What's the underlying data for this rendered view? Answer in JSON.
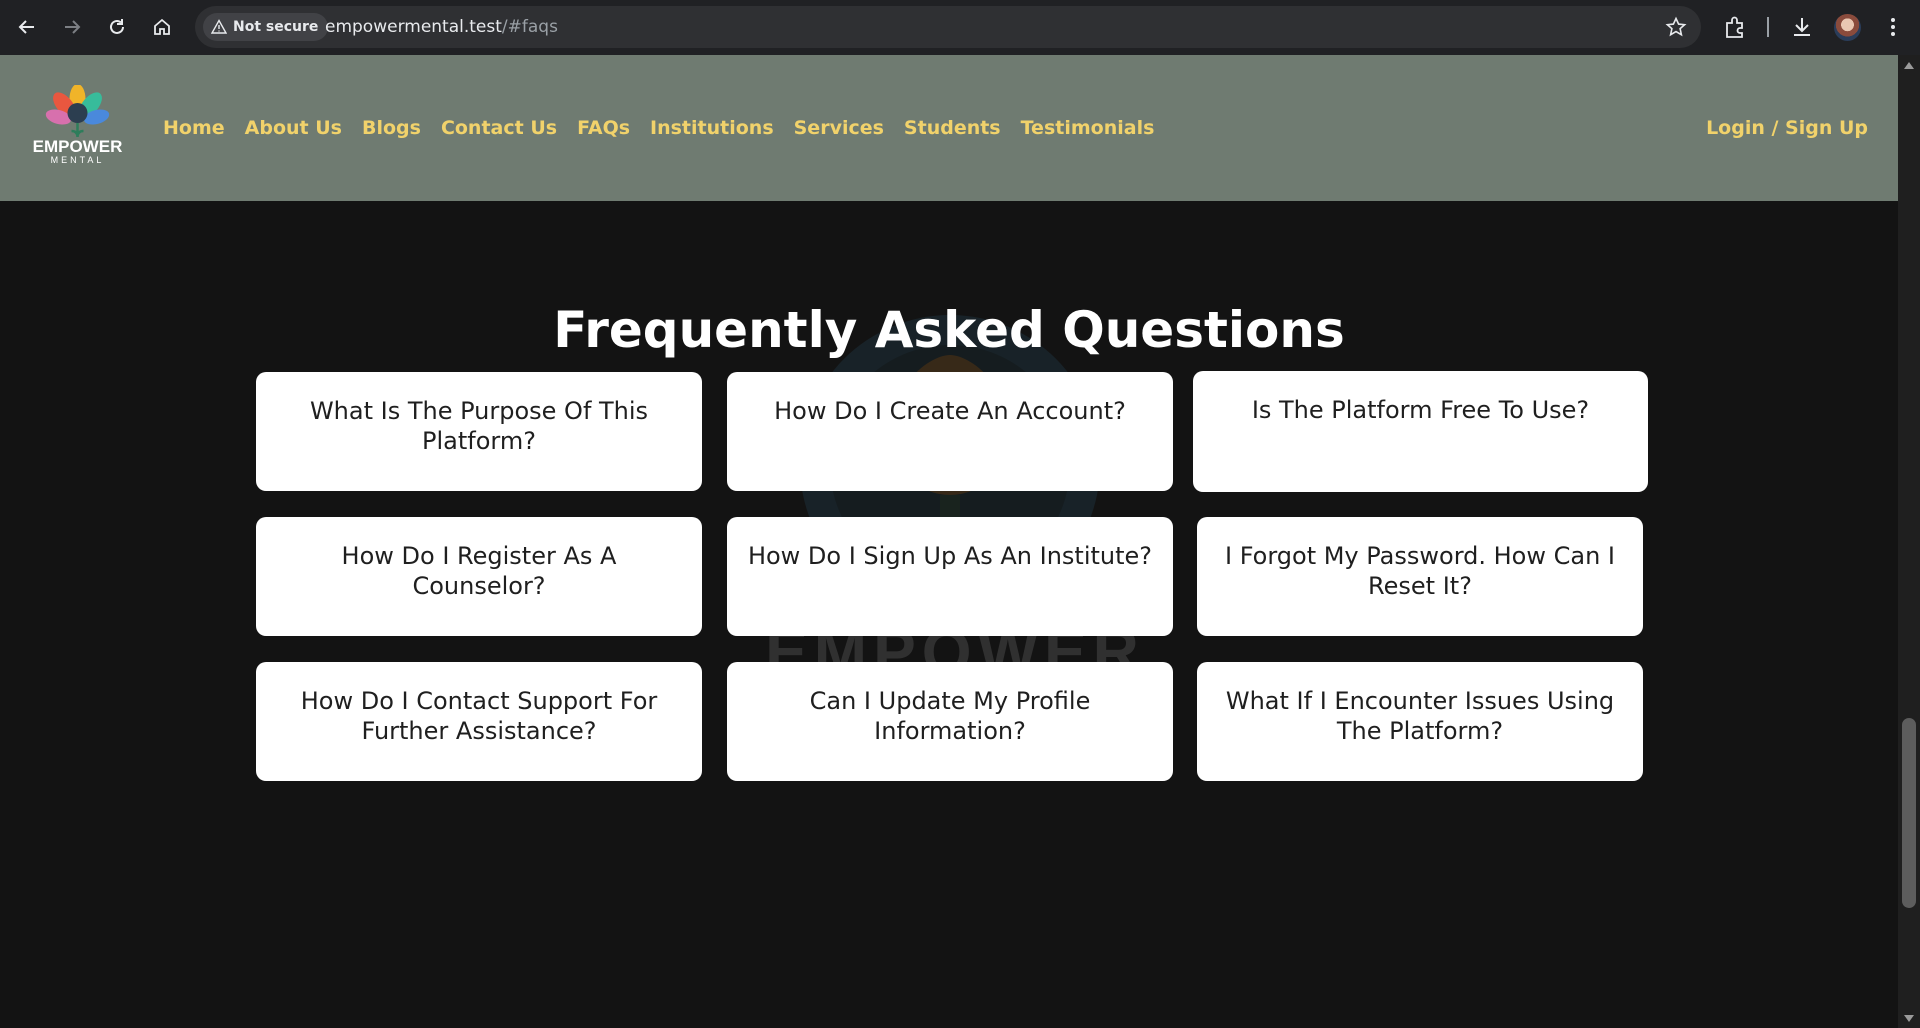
{
  "browser": {
    "security_label": "Not secure",
    "url_host": "empowermental.test",
    "url_path": "/#faqs"
  },
  "site": {
    "logo_text": "EMPOWER",
    "logo_subtext": "MENTAL",
    "nav": [
      "Home",
      "About Us",
      "Blogs",
      "Contact Us",
      "FAQs",
      "Institutions",
      "Services",
      "Students",
      "Testimonials"
    ],
    "login_label": "Login / Sign Up",
    "accent_color": "#f1d26b",
    "header_color": "#6f7b71"
  },
  "faq": {
    "title": "Frequently Asked Questions",
    "questions": [
      "What Is The Purpose Of This Platform?",
      "How Do I Create An Account?",
      "Is The Platform Free To Use?",
      "How Do I Register As A Counselor?",
      "How Do I Sign Up As An Institute?",
      "I Forgot My Password. How Can I Reset It?",
      "How Do I Contact Support For Further Assistance?",
      "Can I Update My Profile Information?",
      "What If I Encounter Issues Using The Platform?"
    ]
  }
}
